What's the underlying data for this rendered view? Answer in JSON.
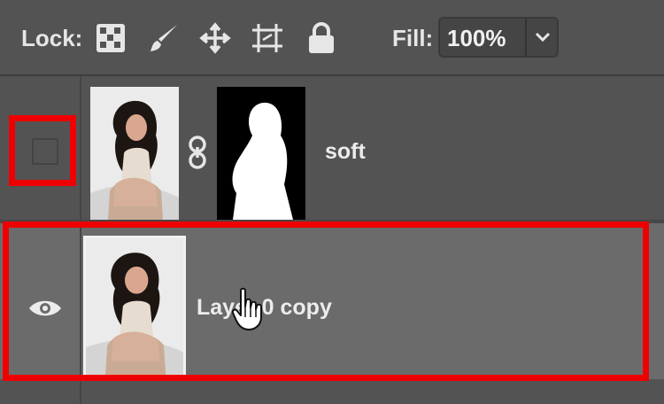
{
  "toolbar": {
    "lock_label": "Lock:",
    "lock_icons": [
      "lock-transparent-pixels-icon",
      "lock-image-pixels-icon",
      "lock-position-icon",
      "lock-artboard-icon",
      "lock-all-icon"
    ],
    "fill_label": "Fill:",
    "fill_value": "100%",
    "fill_dropdown_icon": "chevron-down-icon"
  },
  "layers": [
    {
      "name": "soft",
      "visible": false,
      "has_mask": true,
      "link_icon": "chain-link-icon"
    },
    {
      "name": "Layer 0 copy",
      "visible": true,
      "selected": true,
      "visibility_icon": "eye-icon"
    }
  ],
  "colors": {
    "panel_bg": "#535353",
    "selected_row_bg": "#6b6b6b",
    "highlight": "#ef0000",
    "text": "#ececec"
  }
}
